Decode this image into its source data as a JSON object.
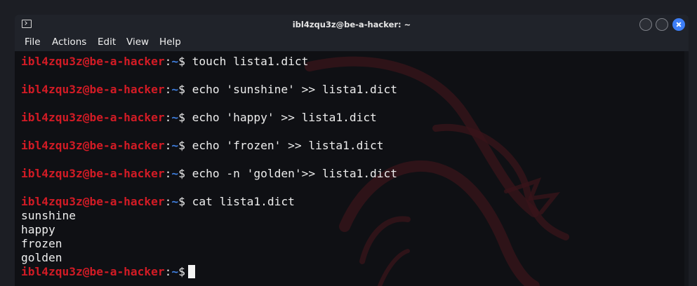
{
  "window": {
    "title": "ibl4zqu3z@be-a-hacker: ~"
  },
  "menu": {
    "file": "File",
    "actions": "Actions",
    "edit": "Edit",
    "view": "View",
    "help": "Help"
  },
  "prompt": {
    "user_host": "ibl4zqu3z@be-a-hacker",
    "colon": ":",
    "path": "~",
    "dollar": "$"
  },
  "commands": [
    "touch lista1.dict",
    "echo 'sunshine' >> lista1.dict",
    "echo 'happy' >> lista1.dict",
    "echo 'frozen' >> lista1.dict",
    "echo -n 'golden'>> lista1.dict",
    "cat lista1.dict"
  ],
  "output": [
    "sunshine",
    "happy",
    "frozen",
    "golden"
  ],
  "colors": {
    "prompt_user": "#d21b25",
    "prompt_path": "#3f7fe0",
    "text": "#ededed",
    "terminal_bg": "#0f1014",
    "close_button": "#3d7ef6"
  }
}
